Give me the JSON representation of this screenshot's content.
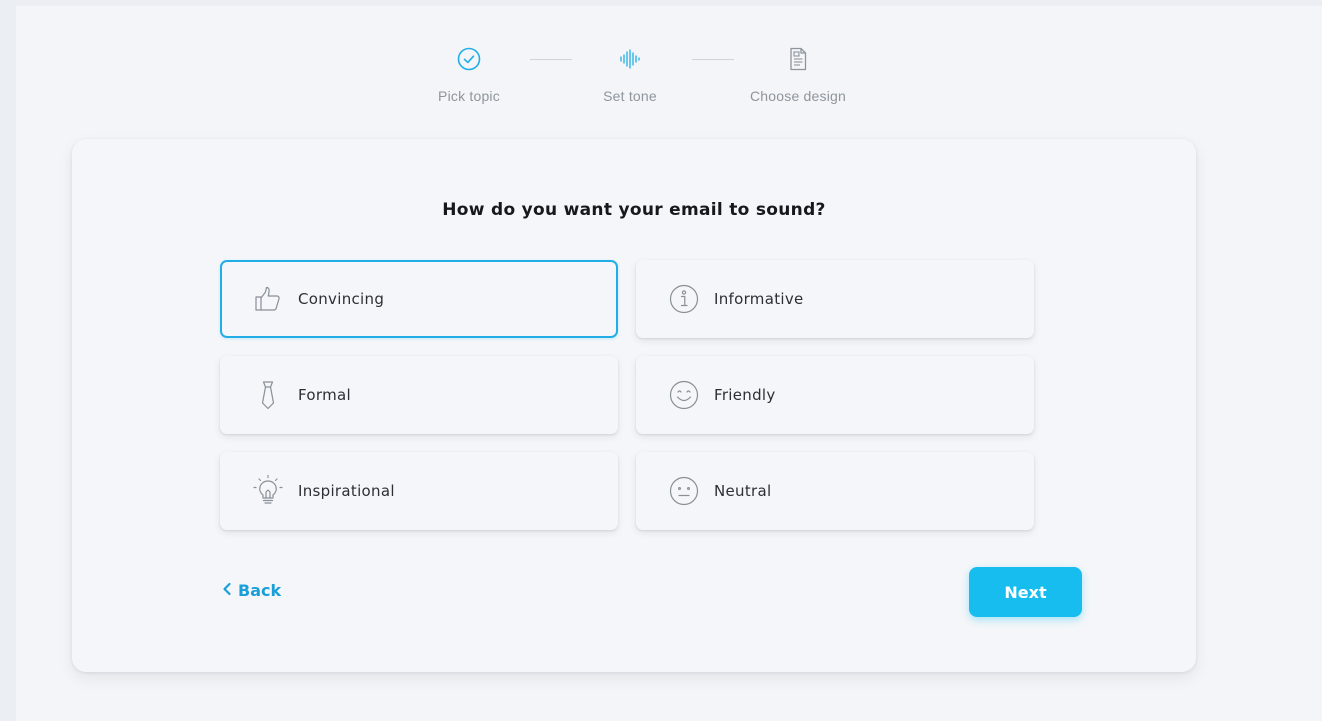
{
  "stepper": {
    "steps": [
      {
        "label": "Pick topic",
        "icon": "check-circle-icon",
        "status": "done"
      },
      {
        "label": "Set tone",
        "icon": "sound-wave-icon",
        "status": "current"
      },
      {
        "label": "Choose design",
        "icon": "document-icon",
        "status": "upcoming"
      }
    ]
  },
  "card": {
    "question": "How do you want your email to sound?",
    "options": [
      {
        "label": "Convincing",
        "icon": "thumbs-up-icon",
        "selected": true
      },
      {
        "label": "Informative",
        "icon": "info-icon",
        "selected": false
      },
      {
        "label": "Formal",
        "icon": "tie-icon",
        "selected": false
      },
      {
        "label": "Friendly",
        "icon": "smiley-icon",
        "selected": false
      },
      {
        "label": "Inspirational",
        "icon": "lightbulb-icon",
        "selected": false
      },
      {
        "label": "Neutral",
        "icon": "neutral-face-icon",
        "selected": false
      }
    ],
    "back_label": "Back",
    "next_label": "Next"
  },
  "colors": {
    "accent": "#21aee6",
    "next_button": "#18bdf0",
    "background": "#f3f5f8"
  }
}
